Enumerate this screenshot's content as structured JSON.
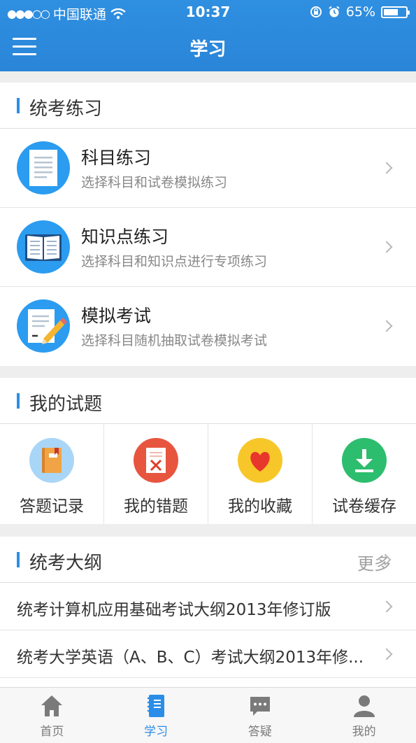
{
  "status_bar": {
    "signal": "●●●○○",
    "carrier": "中国联通",
    "time": "10:37",
    "battery": "65%",
    "battery_level": 0.65
  },
  "nav": {
    "title": "学习"
  },
  "sections": {
    "exam_practice": {
      "title": "统考练习",
      "items": [
        {
          "title": "科目练习",
          "subtitle": "选择科目和试卷模拟练习",
          "icon": "document-icon"
        },
        {
          "title": "知识点练习",
          "subtitle": "选择科目和知识点进行专项练习",
          "icon": "open-book-icon"
        },
        {
          "title": "模拟考试",
          "subtitle": "选择科目随机抽取试卷模拟考试",
          "icon": "paper-pencil-icon"
        }
      ]
    },
    "my_questions": {
      "title": "我的试题",
      "items": [
        {
          "label": "答题记录",
          "icon": "notebook-icon",
          "color": "#a9d6f7"
        },
        {
          "label": "我的错题",
          "icon": "wrong-paper-icon",
          "color": "#e8553f"
        },
        {
          "label": "我的收藏",
          "icon": "heart-icon",
          "color": "#f7c72a"
        },
        {
          "label": "试卷缓存",
          "icon": "download-icon",
          "color": "#2dbd6e"
        }
      ]
    },
    "syllabus": {
      "title": "统考大纲",
      "more": "更多",
      "items": [
        {
          "text": "统考计算机应用基础考试大纲2013年修订版"
        },
        {
          "text": "统考大学英语（A、B、C）考试大纲2013年修..."
        }
      ]
    }
  },
  "tabbar": {
    "items": [
      {
        "label": "首页",
        "icon": "home-icon"
      },
      {
        "label": "学习",
        "icon": "study-book-icon",
        "active": true
      },
      {
        "label": "答疑",
        "icon": "chat-bubble-icon"
      },
      {
        "label": "我的",
        "icon": "user-icon"
      }
    ]
  },
  "colors": {
    "primary": "#2a8ee8",
    "header": "#2f8fe0"
  }
}
